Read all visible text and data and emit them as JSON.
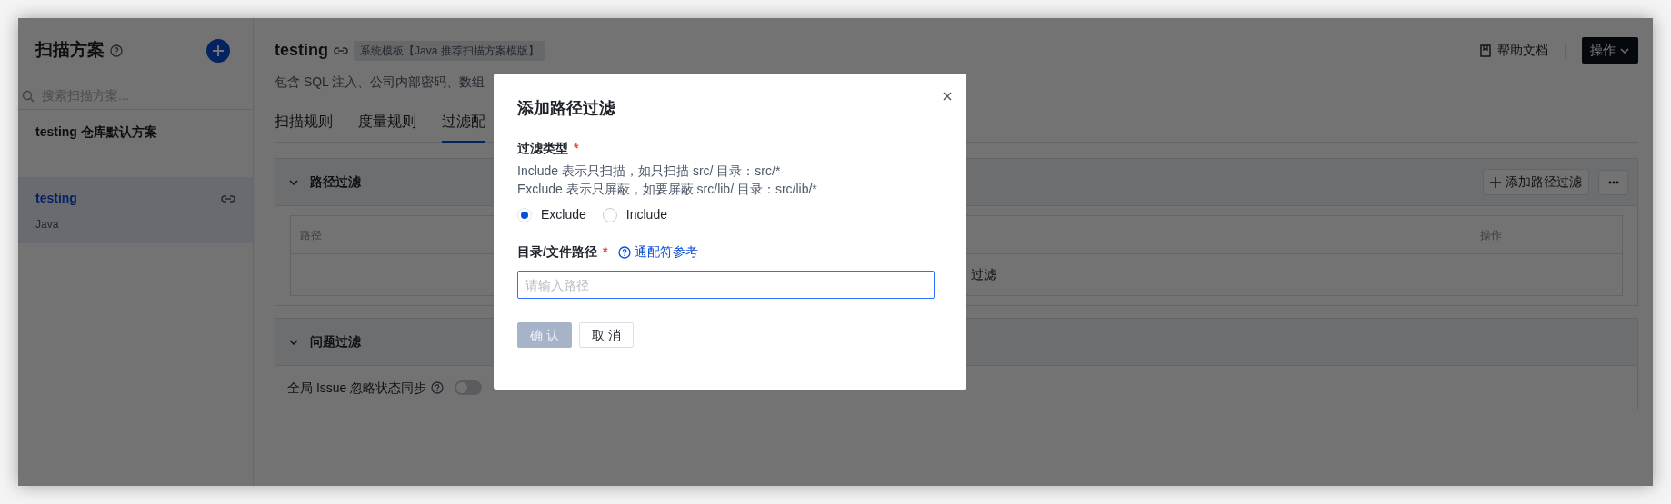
{
  "sidebar": {
    "title": "扫描方案",
    "search": {
      "placeholder": "搜索扫描方案..."
    },
    "items": [
      {
        "name": "testing 仓库默认方案",
        "selected": false
      },
      {
        "name": "testing",
        "subtitle": "Java",
        "selected": true
      }
    ]
  },
  "header": {
    "title": "testing",
    "tag": "系统模板【Java 推荐扫描方案模版】",
    "description": "包含 SQL 注入、公司内部密码、数组",
    "help_link": "帮助文档",
    "action_button": "操作"
  },
  "tabs": [
    {
      "label": "扫描规则",
      "selected": false
    },
    {
      "label": "度量规则",
      "selected": false
    },
    {
      "label": "过滤配",
      "selected": true
    }
  ],
  "path_filter_panel": {
    "title": "路径过滤",
    "expanded": true,
    "add_button": "添加路径过滤",
    "columns": [
      "路径",
      "操作"
    ],
    "empty_text": "过滤"
  },
  "issue_filter_panel": {
    "title": "问题过滤",
    "expanded": true,
    "toggle_label": "全局 Issue 忽略状态同步",
    "toggle_on": false
  },
  "modal": {
    "title": "添加路径过滤",
    "fields": [
      {
        "kind": "radio",
        "label": "过滤类型",
        "required_mark": "*",
        "help": [
          "Include 表示只扫描，如只扫描 src/ 目录：src/*",
          "Exclude 表示只屏蔽，如要屏蔽 src/lib/ 目录：src/lib/*"
        ],
        "options": [
          {
            "label": "Exclude",
            "selected": true
          },
          {
            "label": "Include",
            "selected": false
          }
        ]
      },
      {
        "kind": "text",
        "label": "目录/文件路径",
        "required_mark": "*",
        "link": "通配符参考",
        "placeholder": "请输入路径",
        "focused": true
      }
    ],
    "buttons": [
      {
        "label": "确 认",
        "kind": "primary",
        "disabled": true
      },
      {
        "label": "取 消",
        "kind": "default",
        "disabled": false
      }
    ]
  }
}
